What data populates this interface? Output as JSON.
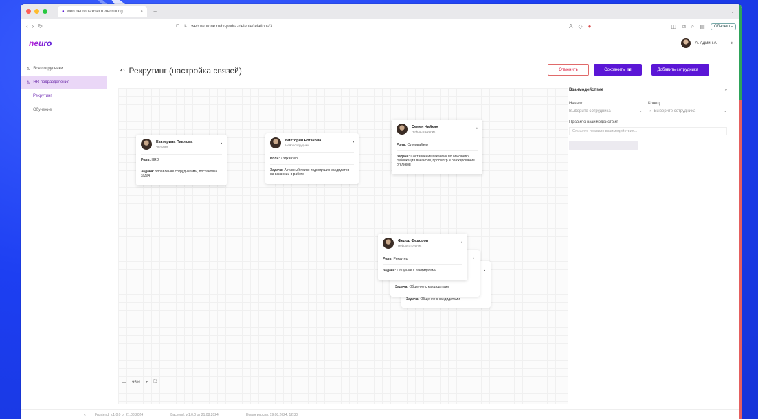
{
  "browser": {
    "tab_title": "web.neuronsreset.ru/recruiting",
    "url": "web.neurone.ru/hr-podrazdelenie/relations/3",
    "update_label": "Обновить",
    "colors": {
      "red": "#ff5f57",
      "yellow": "#febc2e",
      "green": "#28c840"
    }
  },
  "header": {
    "logo": "neuro",
    "user_name": "А. Админ А."
  },
  "sidebar": {
    "items": [
      {
        "label": "Все сотрудники"
      },
      {
        "label": "HR подразделения"
      }
    ],
    "subitems": [
      {
        "label": "Рекрутинг"
      },
      {
        "label": "Обучение"
      }
    ]
  },
  "page": {
    "title": "Рекрутинг (настройка связей)",
    "cancel_label": "Отменить",
    "save_label": "Сохранить",
    "add_label": "Добавить сотрудника"
  },
  "cards": [
    {
      "name": "Екатерина Павлова",
      "position": "Человек",
      "role_label": "Роль:",
      "role": "HRD",
      "task_label": "Задача:",
      "task": "Управление сотрудниками, постановка задач"
    },
    {
      "name": "Виктория Рогакова",
      "position": "Нейросотрудник",
      "role_label": "Роль:",
      "role": "Хэдхантер",
      "task_label": "Задача:",
      "task": "Активный поиск подходящих кандидатов на вакансии в работе"
    },
    {
      "name": "Семен Чайкин",
      "position": "Нейросотрудник",
      "role_label": "Роль:",
      "role": "Супервайзер",
      "task_label": "Задача:",
      "task": "Составление вакансий по описанию, публикация вакансий, просмотр и ранжирование откликов"
    },
    {
      "name": "Федор Федоров",
      "position": "Нейросотрудник",
      "role_label": "Роль:",
      "role": "Рекрутер",
      "task_label": "Задача:",
      "task": "Общение с кандидатами"
    },
    {
      "task_label": "Задача:",
      "task": "Общение с кандидатами"
    },
    {
      "task_label": "Задача:",
      "task": "Общение с кандидатами"
    }
  ],
  "zoom": {
    "minus": "—",
    "value": "95%",
    "plus": "+"
  },
  "panel": {
    "title": "Взаимодействие",
    "start_label": "Начало",
    "end_label": "Конец",
    "start_placeholder": "Выберите сотрудника",
    "end_placeholder": "Выберите сотрудника",
    "rule_label": "Правило взаимодействия",
    "rule_placeholder": "Опишите правило взаимодействия..."
  },
  "status": {
    "items": [
      "Frontend: v.1.0.0 от 21.08.2024",
      "Backend: v.1.0.0 от 21.08.2024",
      "Новая версия: 19.08.2024, 12:30"
    ]
  }
}
